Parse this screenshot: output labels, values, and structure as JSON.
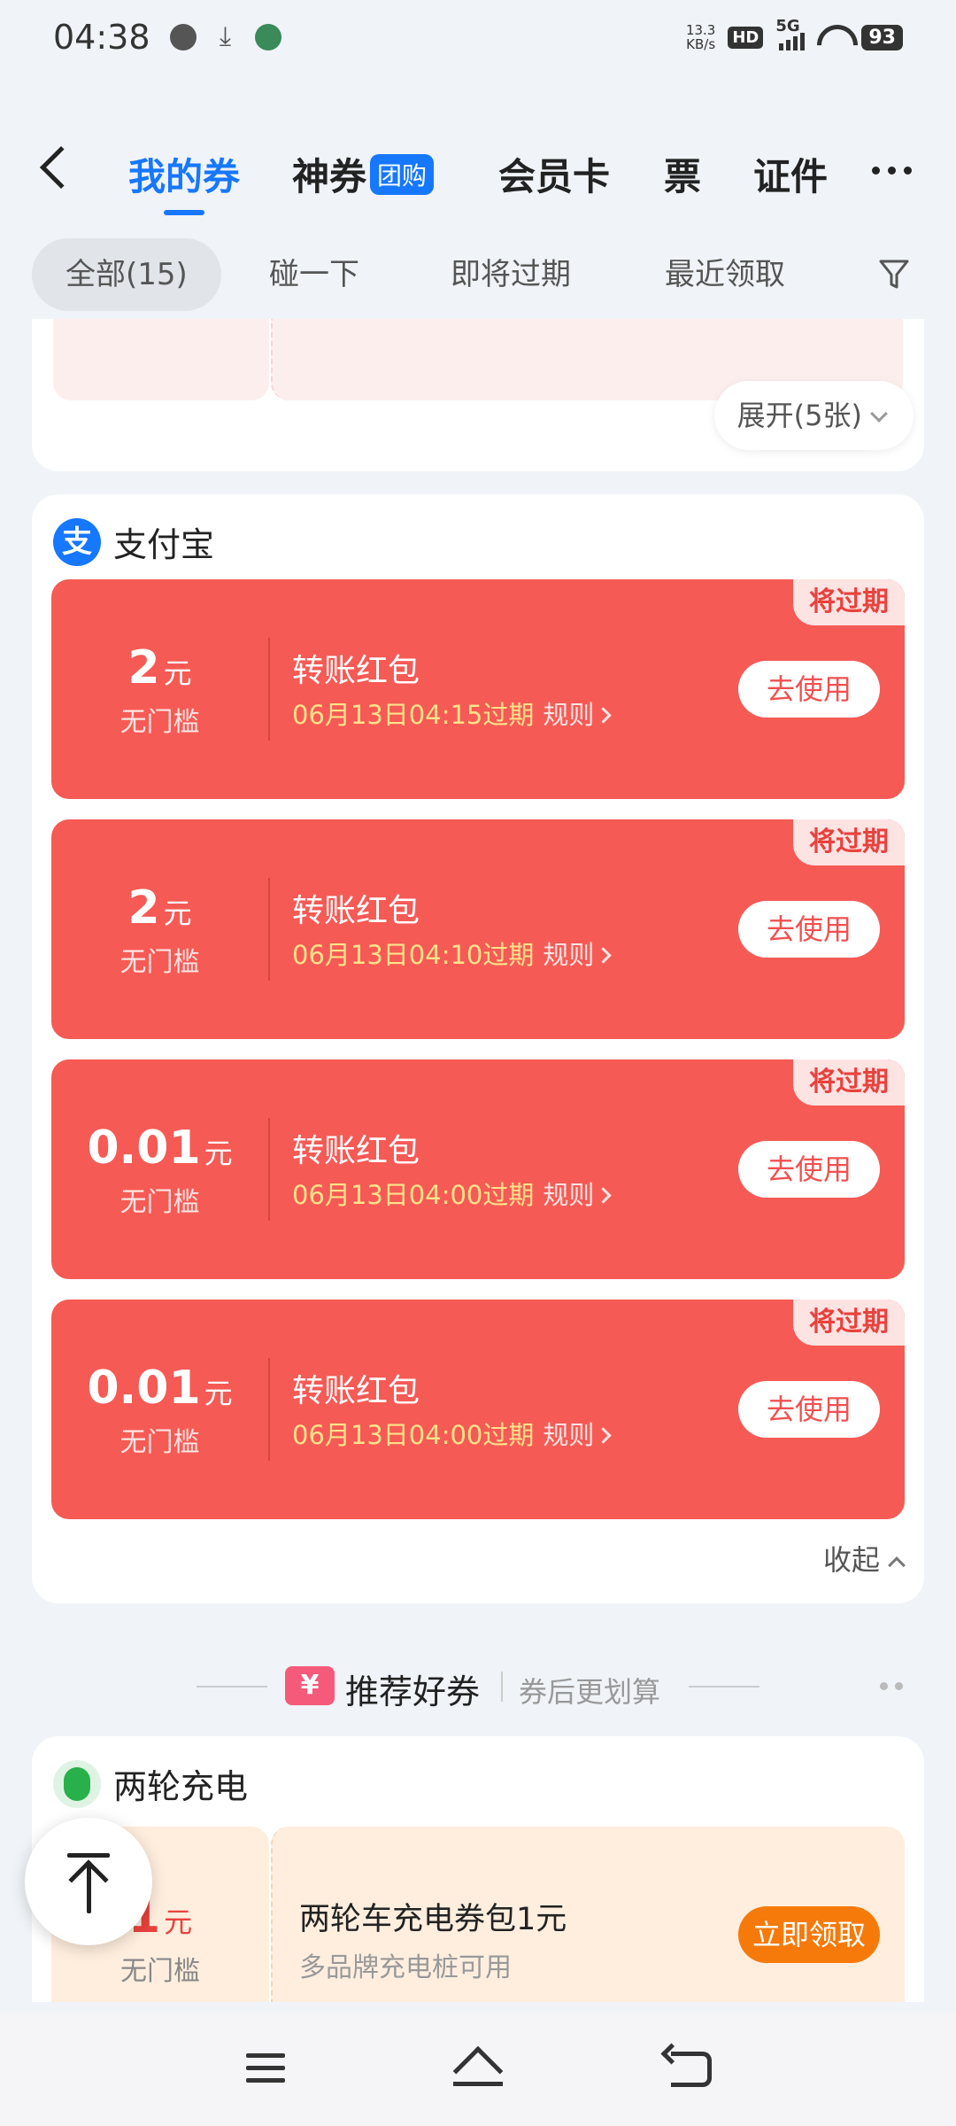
{
  "status_bar": {
    "time": "04:38",
    "net_speed_value": "13.3",
    "net_speed_unit": "KB/s",
    "hd": "HD",
    "network": "5G",
    "battery": "93"
  },
  "nav": {
    "tabs": [
      {
        "label": "我的券"
      },
      {
        "label": "神券",
        "badge": "团购"
      },
      {
        "label": "会员卡"
      },
      {
        "label": "票"
      },
      {
        "label": "证件"
      }
    ]
  },
  "filters": {
    "items": [
      "全部(15)",
      "碰一下",
      "即将过期",
      "最近领取"
    ]
  },
  "prev_section": {
    "expand_label": "展开(5张)"
  },
  "alipay_section": {
    "title": "支付宝",
    "logo_char": "支",
    "coupons": [
      {
        "amount": "2",
        "unit": "元",
        "condition": "无门槛",
        "title": "转账红包",
        "expiry": "06月13日04:15过期",
        "rule": "规则",
        "button": "去使用",
        "tag": "将过期"
      },
      {
        "amount": "2",
        "unit": "元",
        "condition": "无门槛",
        "title": "转账红包",
        "expiry": "06月13日04:10过期",
        "rule": "规则",
        "button": "去使用",
        "tag": "将过期"
      },
      {
        "amount": "0.01",
        "unit": "元",
        "condition": "无门槛",
        "title": "转账红包",
        "expiry": "06月13日04:00过期",
        "rule": "规则",
        "button": "去使用",
        "tag": "将过期"
      },
      {
        "amount": "0.01",
        "unit": "元",
        "condition": "无门槛",
        "title": "转账红包",
        "expiry": "06月13日04:00过期",
        "rule": "规则",
        "button": "去使用",
        "tag": "将过期"
      }
    ],
    "collapse_label": "收起"
  },
  "recommend": {
    "icon_char": "¥",
    "title": "推荐好券",
    "subtitle": "券后更划算"
  },
  "charging_section": {
    "title": "两轮充电",
    "coupon": {
      "amount": "1",
      "unit": "元",
      "condition": "无门槛",
      "title": "两轮车充电券包1元",
      "subtitle": "多品牌充电桩可用",
      "button": "立即领取"
    }
  },
  "colors": {
    "accent": "#1677ff",
    "coupon_red": "#f65a55",
    "expiry_yellow": "#ffe28a",
    "claim_orange": "#f57a0a"
  }
}
